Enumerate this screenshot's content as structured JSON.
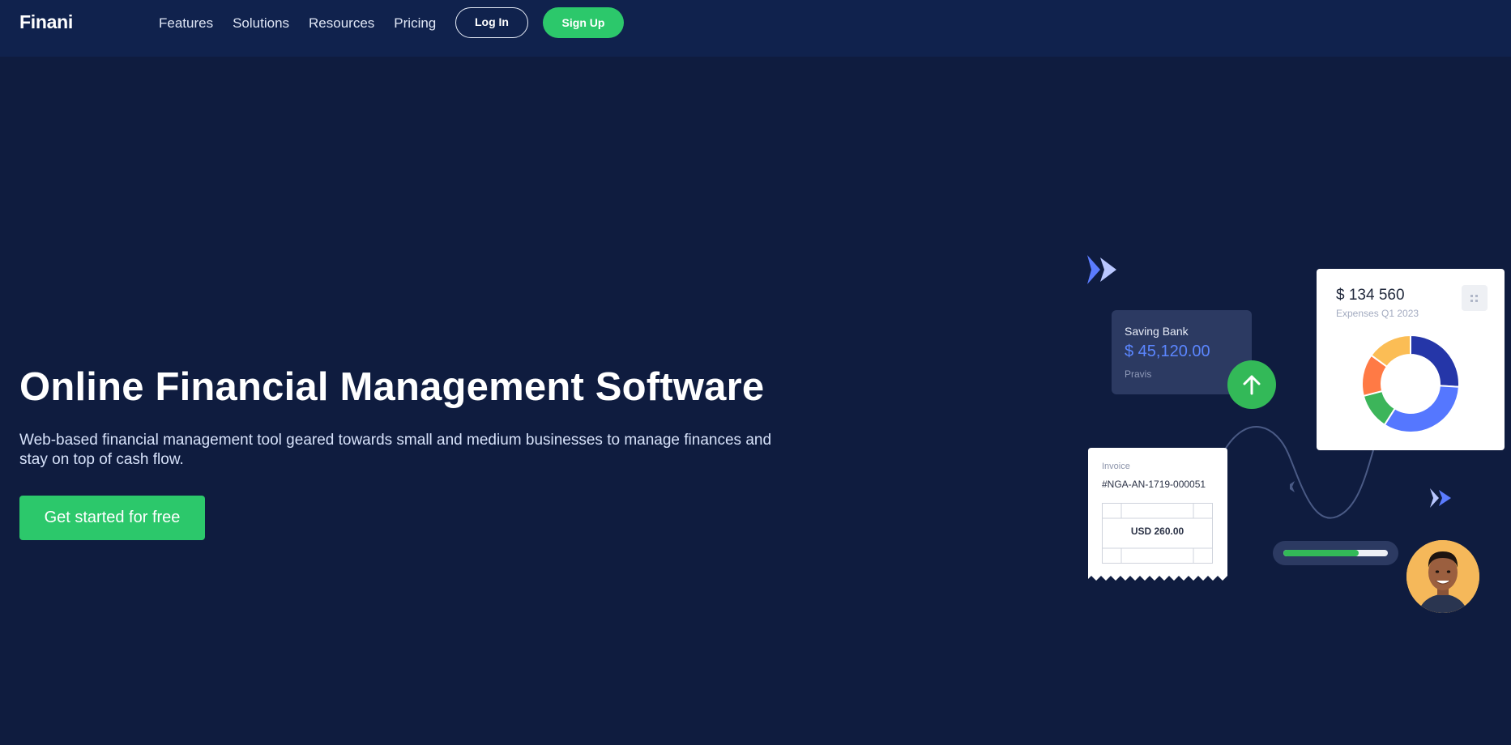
{
  "header": {
    "brand": "Finani",
    "nav": [
      {
        "label": "Features"
      },
      {
        "label": "Solutions"
      },
      {
        "label": "Resources"
      },
      {
        "label": "Pricing"
      }
    ],
    "login_label": "Log In",
    "signup_label": "Sign Up"
  },
  "hero": {
    "title": "Online Financial Management Software",
    "subtitle": "Web-based financial management tool geared towards small and medium businesses to manage finances and stay on top of cash flow.",
    "cta_label": "Get started for free"
  },
  "illustration": {
    "saving_card": {
      "title": "Saving Bank",
      "amount": "$ 45,120.00",
      "name": "Pravis"
    },
    "expense_card": {
      "amount": "$ 134 560",
      "label": "Expenses Q1 2023",
      "segment_colors": [
        "#2536a8",
        "#5577ff",
        "#3cb55a",
        "#ff7a45",
        "#fbbd55"
      ],
      "segment_shares": [
        0.26,
        0.33,
        0.12,
        0.14,
        0.15
      ]
    },
    "invoice": {
      "label": "Invoice",
      "number": "#NGA-AN-1719-000051",
      "amount": "USD 260.00"
    },
    "progress": {
      "fraction": 0.72
    },
    "icons": [
      "sparkle-icon",
      "arrow-up-icon",
      "menu-dots-icon",
      "avatar"
    ]
  },
  "colors": {
    "background": "#0f1c3f",
    "header": "#10224d",
    "accent_green": "#2cc86b",
    "accent_blue": "#5b86ff"
  }
}
